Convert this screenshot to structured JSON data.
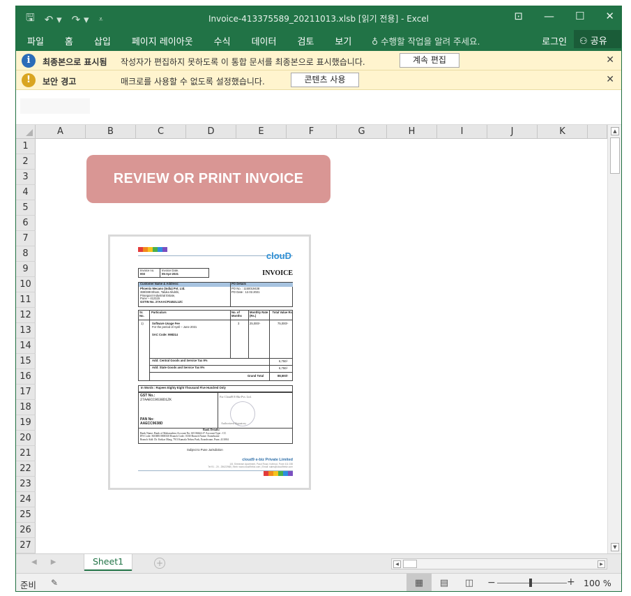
{
  "window": {
    "title": "Invoice-413375589_20211013.xlsb  [읽기 전용] - Excel"
  },
  "ribbon": {
    "tabs": [
      "파일",
      "홈",
      "삽입",
      "페이지 레이아웃",
      "수식",
      "데이터",
      "검토",
      "보기"
    ],
    "tell_me": "수행할 작업을 알려 주세요.",
    "login": "로그인",
    "share": "공유"
  },
  "message_bars": {
    "final": {
      "title": "최종본으로 표시됨",
      "text": "작성자가 편집하지 못하도록 이 통합 문서를 최종본으로 표시했습니다.",
      "button": "계속 편집"
    },
    "security": {
      "title": "보안 경고",
      "text": "매크로를 사용할 수 없도록 설정했습니다.",
      "button": "콘텐츠 사용"
    }
  },
  "grid": {
    "columns": [
      "A",
      "B",
      "C",
      "D",
      "E",
      "F",
      "G",
      "H",
      "I",
      "J",
      "K"
    ],
    "rows": [
      "1",
      "2",
      "3",
      "4",
      "5",
      "6",
      "7",
      "8",
      "9",
      "10",
      "11",
      "12",
      "13",
      "14",
      "15",
      "16",
      "17",
      "18",
      "19",
      "20",
      "21",
      "22",
      "23",
      "24",
      "25",
      "26",
      "27"
    ]
  },
  "overlay": {
    "review_button": "REVIEW OR PRINT INVOICE"
  },
  "invoice": {
    "logo": "clouD",
    "title": "INVOICE",
    "invoice_no_label": "Invoice no.",
    "invoice_no": "003",
    "invoice_date_label": "Invoice Date.",
    "invoice_date": "05-Apr-2021",
    "customer_header": "Customer Name & Address:",
    "po_header": "PO Details",
    "customer_name": "Phoenix Mecano (India) Pvt. Ltd.",
    "customer_addr1": "388/389 Bhare, Taluka Mulshi,",
    "customer_addr2": "Pirangoot Industrial Estate,",
    "customer_addr3": "Pune – 412115",
    "customer_gstin": "GSTIN No. 27AAACP2452L1ZC",
    "po_no": "PO No. : 1150019438",
    "po_date": "PO Date : 12.02.2021",
    "col_sr": "Sr. No.",
    "col_particulars": "Particulars",
    "col_months": "No. of Months",
    "col_rate": "Monthly Rate (Rs.)",
    "col_total": "Total Value Rs.",
    "item_no": "1)",
    "item_name": "Software Usage Fee",
    "item_period": "For the period of April – June 2021",
    "item_sac": "SAC Code: 998314",
    "item_months": "3",
    "item_rate": "25,000/-",
    "item_total": "75,000/-",
    "cgst_label": "Add: Central Goods and Service Tax 9%",
    "cgst_value": "6,750/-",
    "sgst_label": "Add: State Goods and Service Tax 9%",
    "sgst_value": "6,750/-",
    "grand_label": "Grand Total",
    "grand_value": "88,500/-",
    "in_words": "In Words : Rupees Eighty Eight Thousand Five Hundred Only",
    "gst_label": "GST No.:",
    "gst_no": "27AAECC9638D1ZK",
    "for_company": "For Cloud9 E-Biz Pvt. Ltd.",
    "pan_label": "PAN No:",
    "pan_no": "AAECC9638D",
    "signatory": "Authorized Signatory",
    "bank_details": "Bank Details:",
    "bank_name": "Bank Name:  Bank of Maharashtra   Account No:  60136644 47  Account Type : CC",
    "ifs_code": "IFS Code:  MAHB 0000330   Branch Code:  0330   Branch Name: Erandwane",
    "branch_add": "Branch Add:  Dr. Ketkar Marg, 79/3 Kamala Nehru Park, Erandwane, Pune, 411004",
    "jurisdiction": "Subject to Pune Jurisdiction",
    "company_footer": "cloud9 e-biz Private Limited",
    "address_footer": "1/8, Shreeram Apartment, Paud Road, Kothrud, Pune 411 038",
    "contact_footer": "Tel 91 - 20 - 25622968 | Web: www.cloud9ebiz.com | Email: sales@cloud9ebiz.com"
  },
  "sheets": {
    "active": "Sheet1"
  },
  "status": {
    "ready": "준비",
    "zoom": "100 %"
  },
  "colors": {
    "excel_green": "#217346",
    "review_button": "#d99694",
    "message_bar": "#fff4ce"
  }
}
